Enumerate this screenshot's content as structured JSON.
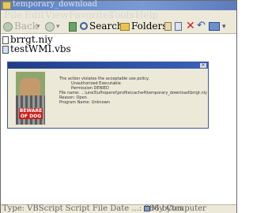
{
  "window": {
    "title": "temporary_download"
  },
  "menu": [
    "File",
    "Edit",
    "View",
    "Favorites",
    "Tools",
    "Help"
  ],
  "toolbar": {
    "back": "Back",
    "search": "Search",
    "folders": "Folders"
  },
  "files": [
    {
      "name": "brrgt.niy"
    },
    {
      "name": "testWMI.vbs"
    }
  ],
  "dialog": {
    "lines": [
      "The action violates the acceptable use policy.",
      "Unauthorized Executable",
      "Permission DENIED",
      "File name:  ...\\une3\\ufhoperst\\profile\\cache4\\temporary_download\\brrgt.niy",
      "Reason: Open",
      "Program Name: Unknown"
    ],
    "sign": "BEWARE OF DOG"
  },
  "status": {
    "left": "Type: VBScript Script File Date ...: 386 bytes",
    "right": "My Computer"
  }
}
